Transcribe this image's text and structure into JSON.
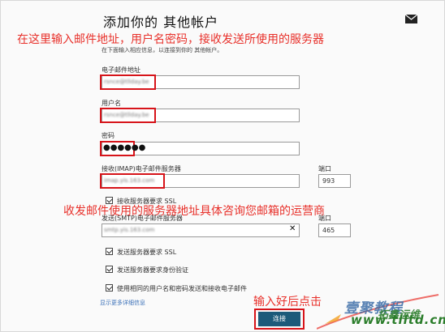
{
  "header": {
    "title": "添加你的 其他帐户"
  },
  "annotations": {
    "top": "在这里输入邮件地址，用户名密码，接收发送所使用的服务器",
    "middle": "收发邮件使用的服务器地址具体咨询您邮箱的运营商",
    "bottom": "输入好后点击"
  },
  "form": {
    "subtitle": "在下面输入相应信息，以连接到你的 其他帐户。",
    "email": {
      "label": "电子邮件地址",
      "value": "rsnce@tllday.be"
    },
    "username": {
      "label": "用户名",
      "value": "rsnce@tllday.be"
    },
    "password": {
      "label": "密码",
      "value": "●●●●●●"
    },
    "imap": {
      "label": "接收(IMAP)电子邮件服务器",
      "value": "imap.yis.163.com"
    },
    "imap_port": {
      "label": "端口",
      "value": "993"
    },
    "imap_ssl": {
      "label": "接收服务器要求 SSL",
      "checked": true
    },
    "smtp": {
      "label": "发送(SMTP)电子邮件服务器",
      "value": "smtp.yis.163.com"
    },
    "smtp_port": {
      "label": "端口",
      "value": "465"
    },
    "smtp_ssl": {
      "label": "发送服务器要求 SSL",
      "checked": true
    },
    "smtp_auth": {
      "label": "发送服务器要求身份验证",
      "checked": true
    },
    "same_creds": {
      "label": "使用相同的用户名和密码发送和接收电子邮件",
      "checked": true
    },
    "more_link": "显示更多详细信息",
    "connect_label": "连接"
  },
  "watermark": {
    "cn": "壹聚教程",
    "cn2": "拓鑫运维",
    "site": "www.tlltd.cn"
  }
}
